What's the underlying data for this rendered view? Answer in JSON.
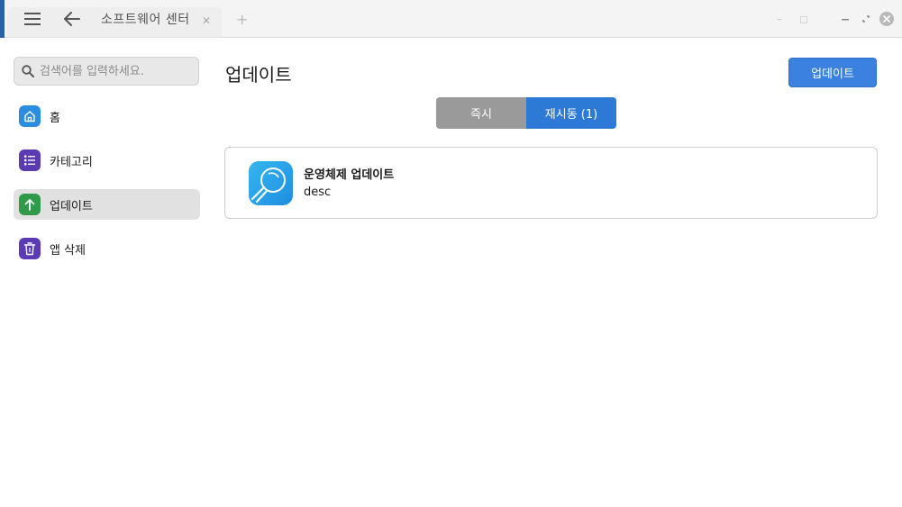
{
  "window": {
    "title": "소프트웨어 센터"
  },
  "sidebar": {
    "search_placeholder": "검색어를 입력하세요.",
    "items": [
      {
        "label": "홈",
        "icon": "home-icon",
        "color": "#2a8de0"
      },
      {
        "label": "카테고리",
        "icon": "category-list-icon",
        "color": "#5b3bb3"
      },
      {
        "label": "업데이트",
        "icon": "arrow-up-icon",
        "color": "#2f9a47",
        "active": true
      },
      {
        "label": "앱 삭제",
        "icon": "trash-icon",
        "color": "#5b3bb3"
      }
    ]
  },
  "main": {
    "title": "업데이트",
    "update_button": "업데이트",
    "tabs": [
      {
        "label": "즉시",
        "active": false
      },
      {
        "label": "재시동 (1)",
        "active": true
      }
    ],
    "updates": [
      {
        "name": "운영체제 업데이트",
        "desc": "desc",
        "icon": "os-update-icon"
      }
    ]
  },
  "colors": {
    "accent": "#3b82e0",
    "tab_active": "#2d7ad6",
    "tab_inactive": "#9a9a9a",
    "sidebar_active_bg": "#e1e1e1"
  }
}
